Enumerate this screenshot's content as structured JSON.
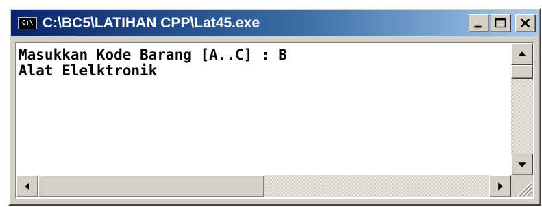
{
  "window": {
    "title": "C:\\BC5\\LATIHAN CPP\\Lat45.exe",
    "icon_label": "C:\\",
    "icon": "console-app-icon",
    "controls": {
      "minimize_icon": "minimize-icon",
      "maximize_icon": "maximize-icon",
      "close_icon": "close-icon"
    }
  },
  "console": {
    "lines": [
      "Masukkan Kode Barang [A..C] : B",
      "Alat Elelktronik"
    ]
  },
  "colors": {
    "titlebar_start": "#0a246a",
    "titlebar_end": "#a6caf0",
    "chrome": "#d4d0c8",
    "console_bg": "#ffffff",
    "console_text": "#000000"
  }
}
